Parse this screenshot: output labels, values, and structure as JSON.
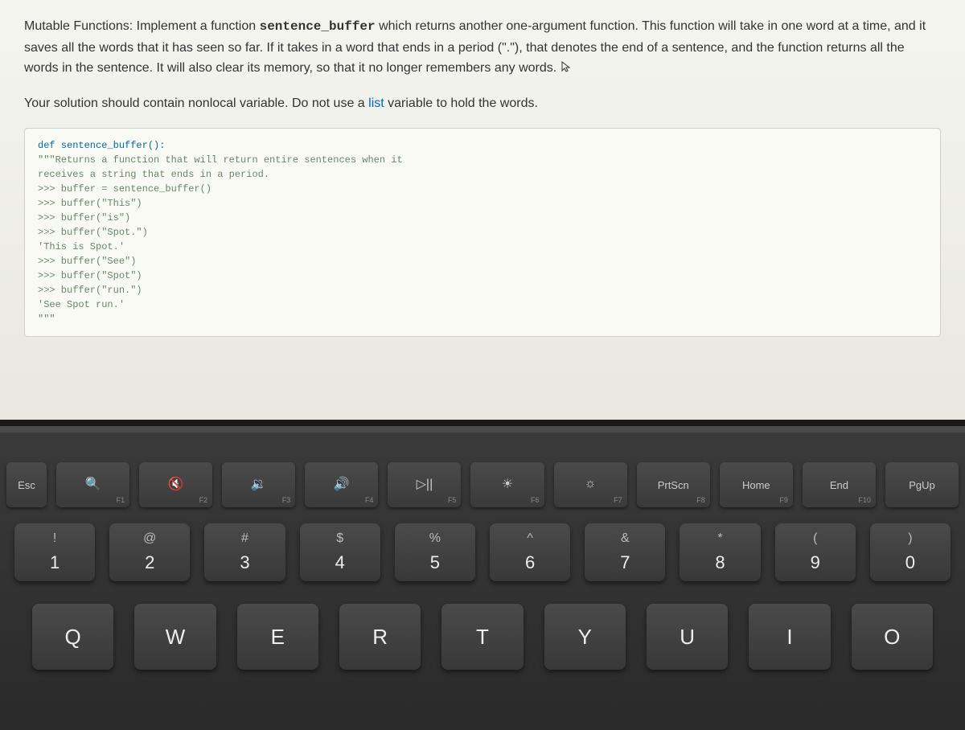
{
  "problem": {
    "paragraph1_prefix": "Mutable Functions: Implement a function ",
    "function_name": "sentence_buffer",
    "paragraph1_mid": " which returns another one-argument function. This function will take in one word at a time, and it saves all the words that it has seen so far. If it takes in a word that ends in a period (\".\"), that denotes the end of a sentence, and the function returns all the words in the sentence. It will also clear its memory, so that it no longer remembers any words.",
    "paragraph2_prefix": "Your solution should contain nonlocal variable. Do not use a ",
    "list_word": "list",
    "paragraph2_suffix": " variable to hold the words."
  },
  "code": {
    "l1": "def sentence_buffer():",
    "l2": "    \"\"\"Returns a function that will return entire sentences when it",
    "l3": "    receives a string that ends in a period.",
    "l4": "    >>> buffer = sentence_buffer()",
    "l5": "    >>> buffer(\"This\")",
    "l6": "    >>> buffer(\"is\")",
    "l7": "    >>> buffer(\"Spot.\")",
    "l8": "    'This is Spot.'",
    "l9": "    >>> buffer(\"See\")",
    "l10": "    >>> buffer(\"Spot\")",
    "l11": "    >>> buffer(\"run.\")",
    "l12": "    'See Spot run.'",
    "l13": "    \"\"\""
  },
  "keyboard": {
    "fn_row": [
      {
        "icon": "Esc",
        "main": "",
        "sub": ""
      },
      {
        "icon": "🔍",
        "main": "",
        "sub": "F1"
      },
      {
        "icon": "🔇",
        "main": "",
        "sub": "F2"
      },
      {
        "icon": "🔉",
        "main": "",
        "sub": "F3"
      },
      {
        "icon": "🔊",
        "main": "",
        "sub": "F4"
      },
      {
        "icon": "▷||",
        "main": "",
        "sub": "F5"
      },
      {
        "icon": "☀",
        "main": "",
        "sub": "F6"
      },
      {
        "icon": "☼",
        "main": "",
        "sub": "F7"
      },
      {
        "icon": "",
        "main": "PrtScn",
        "sub": "F8"
      },
      {
        "icon": "",
        "main": "Home",
        "sub": "F9"
      },
      {
        "icon": "",
        "main": "End",
        "sub": "F10"
      },
      {
        "icon": "",
        "main": "PgUp",
        "sub": ""
      }
    ],
    "num_row": [
      {
        "top": "!",
        "bot": "1"
      },
      {
        "top": "@",
        "bot": "2"
      },
      {
        "top": "#",
        "bot": "3"
      },
      {
        "top": "$",
        "bot": "4"
      },
      {
        "top": "%",
        "bot": "5"
      },
      {
        "top": "^",
        "bot": "6"
      },
      {
        "top": "&",
        "bot": "7"
      },
      {
        "top": "*",
        "bot": "8"
      },
      {
        "top": "(",
        "bot": "9"
      },
      {
        "top": ")",
        "bot": "0"
      }
    ],
    "letter_row": [
      "Q",
      "W",
      "E",
      "R",
      "T",
      "Y",
      "U",
      "I",
      "O"
    ]
  }
}
